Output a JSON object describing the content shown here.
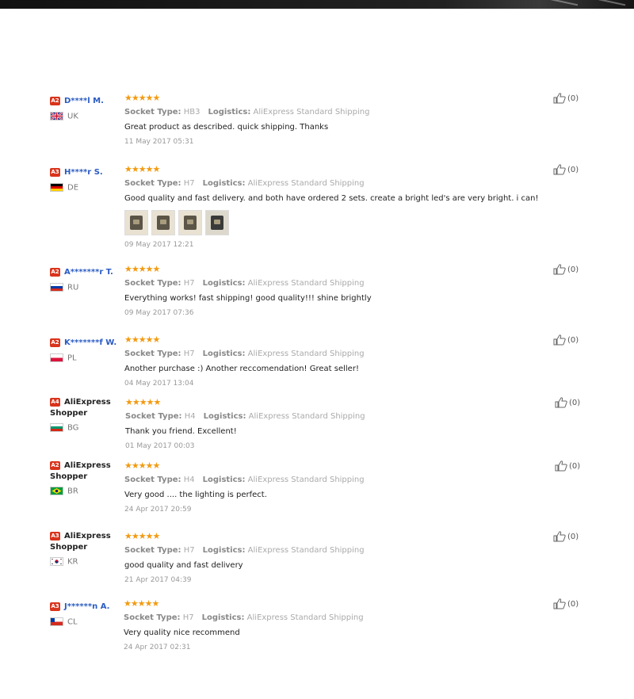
{
  "reviews": [
    {
      "badge": "A2",
      "name": "D****l M.",
      "country": "UK",
      "flag": "uk",
      "stars": "★★★★★",
      "socket_label": "Socket Type:",
      "socket": "HB3",
      "logistics_label": "Logistics:",
      "logistics": "AliExpress Standard Shipping",
      "text": "Great product as described. quick shipping. Thanks",
      "date": "11 May 2017 05:31",
      "likes": "(0)"
    },
    {
      "badge": "A3",
      "name": "H****r S.",
      "country": "DE",
      "flag": "de",
      "stars": "★★★★★",
      "socket_label": "Socket Type:",
      "socket": "H7",
      "logistics_label": "Logistics:",
      "logistics": "AliExpress Standard Shipping",
      "text": "Good quality and fast delivery. and both have ordered 2 sets. create a bright led's are very bright. i can!",
      "date": "09 May 2017 12:21",
      "likes": "(0)",
      "photos": 4
    },
    {
      "badge": "A2",
      "name": "A*******r T.",
      "country": "RU",
      "flag": "ru",
      "stars": "★★★★★",
      "socket_label": "Socket Type:",
      "socket": "H7",
      "logistics_label": "Logistics:",
      "logistics": "AliExpress Standard Shipping",
      "text": "Everything works! fast shipping! good quality!!! shine brightly",
      "date": "09 May 2017 07:36",
      "likes": "(0)"
    },
    {
      "badge": "A2",
      "name": "K*******f W.",
      "country": "PL",
      "flag": "pl",
      "stars": "★★★★★",
      "socket_label": "Socket Type:",
      "socket": "H7",
      "logistics_label": "Logistics:",
      "logistics": "AliExpress Standard Shipping",
      "text": "Another purchase :) Another reccomendation! Great seller!",
      "date": "04 May 2017 13:04",
      "likes": "(0)"
    },
    {
      "badge": "A4",
      "name_line1": "AliExpress",
      "name_line2": "Shopper",
      "country": "BG",
      "flag": "bg",
      "stars": "★★★★★",
      "socket_label": "Socket Type:",
      "socket": "H4",
      "logistics_label": "Logistics:",
      "logistics": "AliExpress Standard Shipping",
      "text": "Thank you friend. Excellent!",
      "date": "01 May 2017 00:03",
      "likes": "(0)"
    },
    {
      "badge": "A2",
      "name_line1": "AliExpress",
      "name_line2": "Shopper",
      "country": "BR",
      "flag": "br",
      "stars": "★★★★★",
      "socket_label": "Socket Type:",
      "socket": "H4",
      "logistics_label": "Logistics:",
      "logistics": "AliExpress Standard Shipping",
      "text": "Very good .... the lighting is perfect.",
      "date": "24 Apr 2017 20:59",
      "likes": "(0)"
    },
    {
      "badge": "A3",
      "name_line1": "AliExpress",
      "name_line2": "Shopper",
      "country": "KR",
      "flag": "kr",
      "stars": "★★★★★",
      "socket_label": "Socket Type:",
      "socket": "H7",
      "logistics_label": "Logistics:",
      "logistics": "AliExpress Standard Shipping",
      "text": "good quality and fast delivery",
      "date": "21 Apr 2017 04:39",
      "likes": "(0)"
    },
    {
      "badge": "A3",
      "name": "J******n A.",
      "country": "CL",
      "flag": "cl",
      "stars": "★★★★★",
      "socket_label": "Socket Type:",
      "socket": "H7",
      "logistics_label": "Logistics:",
      "logistics": "AliExpress Standard Shipping",
      "text": "Very quality nice recommend",
      "date": "24 Apr 2017 02:31",
      "likes": "(0)"
    }
  ],
  "colors": {
    "badge": "#d9341c",
    "star": "#f39a10",
    "username": "#2b5cc2"
  }
}
